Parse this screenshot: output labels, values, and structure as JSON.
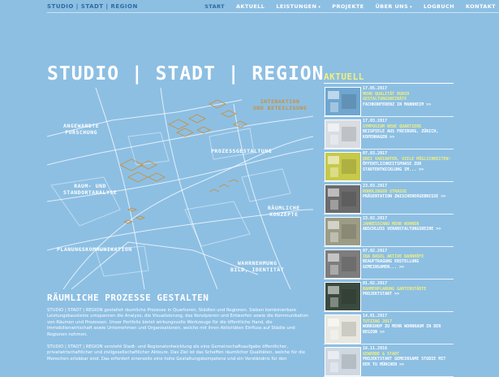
{
  "header": {
    "brand": "STUDIO | STADT | REGION",
    "nav": [
      {
        "label": "START",
        "active": true,
        "dropdown": false
      },
      {
        "label": "AKTUELL",
        "active": false,
        "dropdown": false
      },
      {
        "label": "LEISTUNGEN",
        "active": false,
        "dropdown": true
      },
      {
        "label": "PROJEKTE",
        "active": false,
        "dropdown": false
      },
      {
        "label": "ÜBER UNS",
        "active": false,
        "dropdown": true
      },
      {
        "label": "LOGBUCH",
        "active": false,
        "dropdown": false
      },
      {
        "label": "KONTAKT",
        "active": false,
        "dropdown": false
      }
    ]
  },
  "main": {
    "title": "STUDIO | STADT | REGION",
    "map_labels": {
      "interaktion": "INTERAKTION\nUND BETEILIGUNG",
      "angewandte": "ANGEWANDTE\nFORSCHUNG",
      "prozess": "PROZESSGESTALTUNG",
      "raum": "RAUM- UND\nSTANDORTANALYSE",
      "raeumliche": "RÄUMLICHE\nKONZEPTE",
      "planung": "PLANUNGSKOMMUNIKATION",
      "wahrnehmung": "WAHRNEHMUNG\nBILD, IDENTITÄT"
    },
    "subtitle": "RÄUMLICHE PROZESSE GESTALTEN",
    "paragraph1": "STUDIO | STADT | REGION gestaltet räumliche Prozesse in Quartieren, Städten und Regionen. Sieben kombinierbare Leistungsbausteine umspannen die Analyse, die Visualisierung, das Konzipieren und Entwerfen sowie die Kommunikation von Räumen und Prozessen. Unser Portfolio bietet wirkungsvolle Werkzeuge für die öffentliche Hand, die Immobilienwirtschaft sowie Unternehmen und Organisationen, welche mit ihren Aktivitäten Einfluss auf Städte und Regionen nehmen.",
    "paragraph2": "STUDIO | STADT | REGION versteht Stadt- und Regionalentwicklung als eine Gemeinschaftsaufgabe öffentlicher, privatwirtschaftlicher und zivilgesellschaftlicher Akteure. Das Ziel ist das Schaffen räumlicher Qualitäten, welche für die Menschen erlebbar sind. Das erfordert einerseits eine hohe Gestaltungskompetenz und ein Verständnis für den"
  },
  "sidebar": {
    "title": "AKTUELL",
    "items": [
      {
        "date": "17.05.2017",
        "headline": "MEHR QUALITÄT DURCH GESTALTUNGSBEIRÄTE",
        "teaser": "FACHKONFERENZ IN MANNHEIM >>"
      },
      {
        "date": "17.03.2017",
        "headline": "SYMPOSIUM NEUE QUARTIERE",
        "teaser": "BEISPIELE AUS FREIBURG, ZÜRICH, KOPENHAGEN >>"
      },
      {
        "date": "07.03.2017",
        "headline": "DREI VARIANTEN, VIELE MÖGLICHKEITEN!",
        "teaser": "ÖFFENTLICHKEITSPHASE ZUR STADTENTWICKLUNG IM... >>"
      },
      {
        "date": "23.03.2017",
        "headline": "ROHOLINGER STRASSE",
        "teaser": "PRÄSENTATION ZWISCHENERGEBNISSE >>"
      },
      {
        "date": "23.02.2017",
        "headline": "JAHRESSCHAU MEHR WOHNEN",
        "teaser": "ABSCHLUSS VERANSTALTUNGSREIHE >>"
      },
      {
        "date": "07.02.2017",
        "headline": "IBA BASEL AKTIVE BAHNHÖFE",
        "teaser": "BEAUFTRAGUNG ERSTELLUNG GEMEINSAMEN... >>"
      },
      {
        "date": "01.02.2017",
        "headline": "RAHMENPLANUNG GARTENSTÄDTE",
        "teaser": "PROJEKTSTART >>"
      },
      {
        "date": "14.01.2017",
        "headline": "TUTZING 2017",
        "teaser": "WORKSHOP ZU MEHR WOHNRAUM IN DER REGION >>"
      },
      {
        "date": "16.11.2016",
        "headline": "GEWERBE & STADT",
        "teaser": "PROJEKTSTART GEMEINSAME STUDIE MIT DER TU MÜNCHEN >>"
      }
    ]
  },
  "colors": {
    "background": "#8dbfe3",
    "accent_yellow": "#f2f07a",
    "accent_blue": "#2c6ba3",
    "map_orange": "#c8913f"
  }
}
